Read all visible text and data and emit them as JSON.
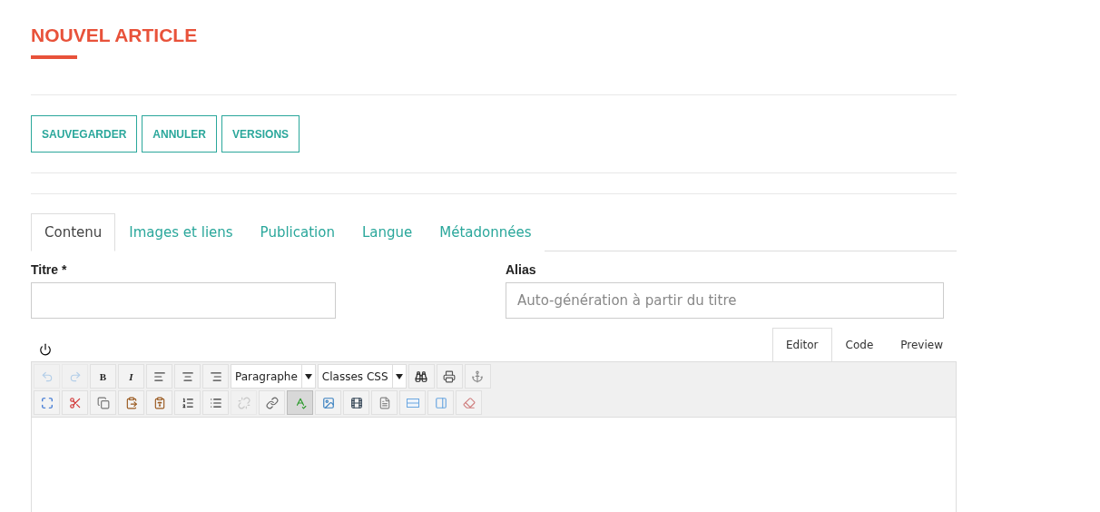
{
  "title": "NOUVEL ARTICLE",
  "actions": [
    {
      "label": "SAUVEGARDER"
    },
    {
      "label": "ANNULER"
    },
    {
      "label": "VERSIONS"
    }
  ],
  "tabs": [
    {
      "label": "Contenu",
      "selected": true
    },
    {
      "label": "Images et liens",
      "selected": false
    },
    {
      "label": "Publication",
      "selected": false
    },
    {
      "label": "Langue",
      "selected": false
    },
    {
      "label": "Métadonnées",
      "selected": false
    }
  ],
  "fields": [
    {
      "label": "Titre *"
    },
    {
      "label": "Alias",
      "placeholder": "Auto-génération à partir du titre"
    }
  ],
  "editor_tabs": [
    {
      "label": "Editor",
      "selected": true
    },
    {
      "label": "Code",
      "selected": false
    },
    {
      "label": "Preview",
      "selected": false
    }
  ],
  "toolbar_rows": [
    [
      {
        "kind": "icon",
        "disabled": true
      },
      {
        "kind": "icon",
        "disabled": true
      },
      {
        "kind": "letter",
        "label": "B",
        "disabled": false
      },
      {
        "kind": "letter",
        "label": "I",
        "disabled": false
      },
      {
        "kind": "icon",
        "disabled": false
      },
      {
        "kind": "icon",
        "disabled": false
      },
      {
        "kind": "icon",
        "disabled": false
      },
      {
        "kind": "select",
        "label": "Paragraphe"
      },
      {
        "kind": "select",
        "label": "Classes CSS"
      },
      {
        "kind": "icon",
        "disabled": false
      },
      {
        "kind": "icon",
        "disabled": false
      },
      {
        "kind": "icon",
        "disabled": false
      }
    ],
    [
      {
        "kind": "icon",
        "disabled": false
      },
      {
        "kind": "icon",
        "disabled": false
      },
      {
        "kind": "icon",
        "disabled": false
      },
      {
        "kind": "icon",
        "disabled": false
      },
      {
        "kind": "icon",
        "disabled": false
      },
      {
        "kind": "icon",
        "disabled": false
      },
      {
        "kind": "icon",
        "disabled": false
      },
      {
        "kind": "icon",
        "disabled": true
      },
      {
        "kind": "icon",
        "disabled": false
      },
      {
        "kind": "icon",
        "disabled": false,
        "selected": true
      },
      {
        "kind": "icon",
        "disabled": false
      },
      {
        "kind": "icon",
        "disabled": false
      },
      {
        "kind": "icon",
        "disabled": false
      },
      {
        "kind": "icon",
        "disabled": false
      },
      {
        "kind": "icon",
        "disabled": false
      },
      {
        "kind": "icon",
        "disabled": false
      }
    ]
  ]
}
